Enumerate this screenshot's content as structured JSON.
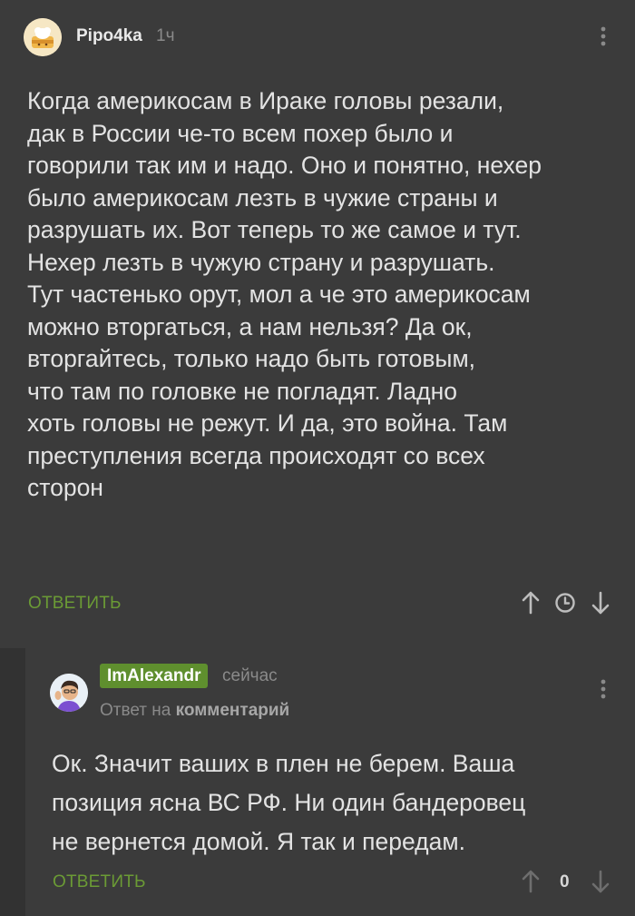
{
  "comment1": {
    "username": "Pipo4ka",
    "time": "1ч",
    "body": "Когда америкосам в Ираке головы резали,\nдак в России че-то всем похер было и\nговорили так им и надо. Оно и понятно, нехер\nбыло америкосам лезть в чужие страны и\nразрушать их. Вот теперь то же самое и тут.\nНехер лезть в чужую страну и разрушать.\nТут частенько орут, мол а че это америкосам\nможно вторгаться, а нам нельзя? Да ок,\nвторгайтесь, только надо быть готовым,\nчто там по головке не погладят. Ладно\nхоть головы не режут. И да, это война. Там\nпреступления всегда происходят со всех\nсторон",
    "reply_label": "ОТВЕТИТЬ",
    "icons": [
      "up-arrow-icon",
      "clock-icon",
      "down-arrow-icon",
      "more-vertical-icon"
    ]
  },
  "comment2": {
    "username": "ImAlexandr",
    "time": "сейчас",
    "reply_to_prefix": "Ответ на",
    "reply_to_link": "комментарий",
    "body": "Ок. Значит ваших в плен не берем. Ваша\nпозиция ясна ВС РФ. Ни один бандеровец\nне вернется домой. Я так и передам.",
    "reply_label": "ОТВЕТИТЬ",
    "rating": "0",
    "icons": [
      "up-arrow-icon",
      "down-arrow-icon",
      "more-vertical-icon"
    ]
  },
  "colors": {
    "background": "#3b3b3b",
    "accent_green": "#6b9b35",
    "badge_green": "#5f8f2e",
    "muted_text": "#8a8a8a"
  }
}
